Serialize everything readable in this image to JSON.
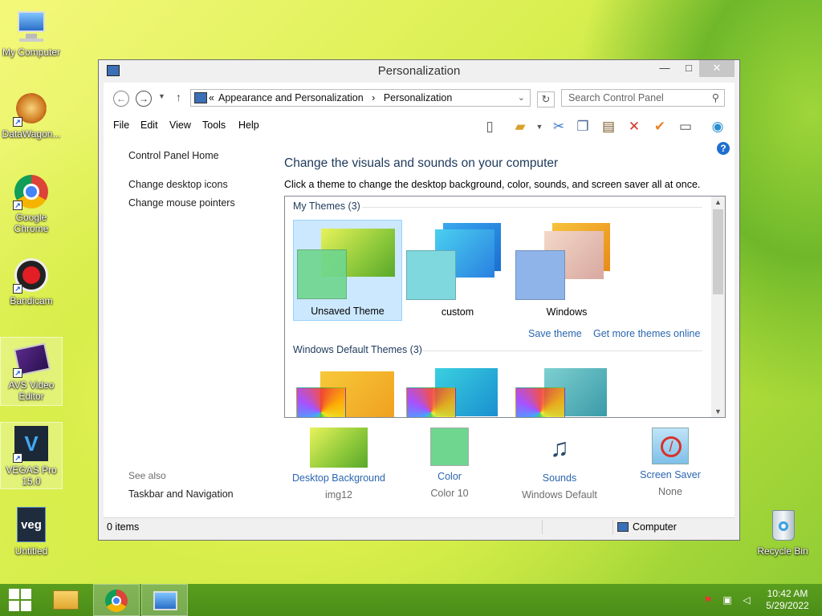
{
  "desktop": {
    "icons": [
      {
        "label": "My Computer"
      },
      {
        "label": "DataWagon..."
      },
      {
        "label": "Google Chrome"
      },
      {
        "label": "Bandicam"
      },
      {
        "label": "AVS Video Editor"
      },
      {
        "label": "VEGAS Pro 15.0"
      },
      {
        "label": "Untitled"
      },
      {
        "label": "Recycle Bin"
      }
    ]
  },
  "window": {
    "title": "Personalization",
    "address": {
      "prefix": "«",
      "crumb1": "Appearance and Personalization",
      "sep": "›",
      "crumb2": "Personalization"
    },
    "search_placeholder": "Search Control Panel",
    "menu": [
      "File",
      "Edit",
      "View",
      "Tools",
      "Help"
    ],
    "left_nav": {
      "home": "Control Panel Home",
      "links": [
        "Change desktop icons",
        "Change mouse pointers"
      ],
      "see_also_label": "See also",
      "see_also": [
        "Taskbar and Navigation"
      ]
    },
    "heading": "Change the visuals and sounds on your computer",
    "instructions": "Click a theme to change the desktop background, color, sounds, and screen saver all at once.",
    "my_themes_label": "My Themes (3)",
    "my_themes": [
      {
        "name": "Unsaved Theme",
        "color": "#6ed68f"
      },
      {
        "name": "custom",
        "color": "#7fd8de"
      },
      {
        "name": "Windows",
        "color": "#8fb4ea"
      }
    ],
    "save_theme": "Save theme",
    "get_more": "Get more themes online",
    "default_themes_label": "Windows Default Themes (3)",
    "bottom_items": [
      {
        "title": "Desktop Background",
        "value": "img12"
      },
      {
        "title": "Color",
        "value": "Color 10"
      },
      {
        "title": "Sounds",
        "value": "Windows Default"
      },
      {
        "title": "Screen Saver",
        "value": "None"
      }
    ],
    "status": {
      "items": "0 items",
      "location": "Computer"
    }
  },
  "taskbar": {
    "time": "10:42 AM",
    "date": "5/29/2022"
  },
  "colors": {
    "accent": "#2a66b0",
    "taskbar": "#4b8d18",
    "selected_theme": "#cce8ff"
  }
}
